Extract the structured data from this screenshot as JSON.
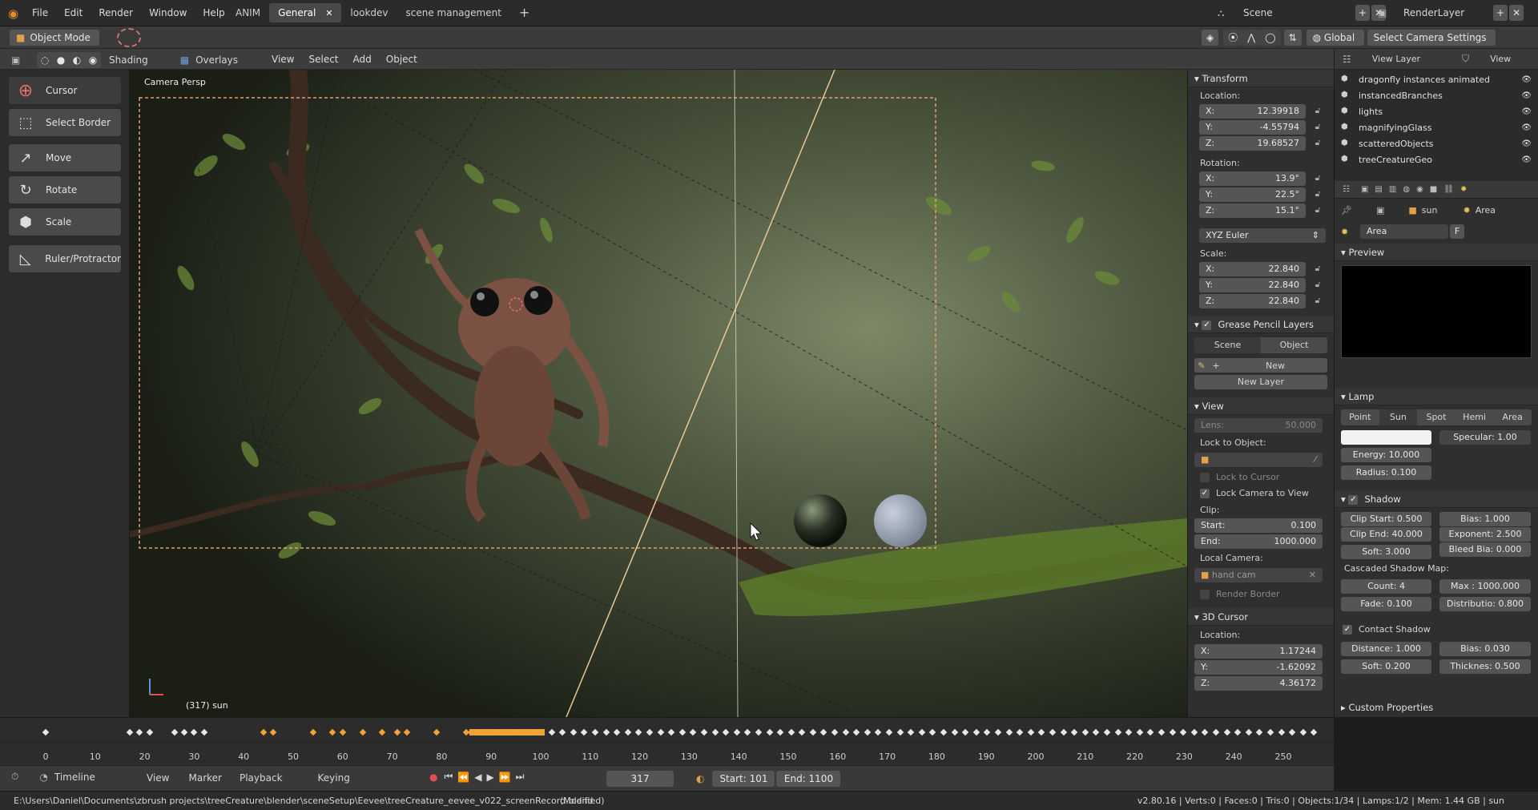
{
  "menu": {
    "items": [
      "File",
      "Edit",
      "Render",
      "Window",
      "Help"
    ]
  },
  "workspace_tabs": [
    "ANIM",
    "General",
    "lookdev",
    "scene management"
  ],
  "scene": {
    "label": "Scene",
    "render_layer": "RenderLayer"
  },
  "header2": {
    "mode": "Object Mode",
    "transform_orientation": "Global",
    "camera_settings": "Select Camera Settings"
  },
  "header3": {
    "shading": "Shading",
    "overlays": "Overlays",
    "menus": [
      "View",
      "Select",
      "Add",
      "Object"
    ]
  },
  "outliner_header": {
    "view_layer": "View Layer",
    "view": "View"
  },
  "tools": [
    "Cursor",
    "Select Border",
    "Move",
    "Rotate",
    "Scale",
    "Ruler/Protractor"
  ],
  "viewport": {
    "title": "Camera Persp",
    "frame_info": "(317) sun"
  },
  "npanel": {
    "transform": {
      "title": "Transform",
      "location_label": "Location:",
      "location": [
        {
          "axis": "X:",
          "value": "12.39918"
        },
        {
          "axis": "Y:",
          "value": "-4.55794"
        },
        {
          "axis": "Z:",
          "value": "19.68527"
        }
      ],
      "rotation_label": "Rotation:",
      "rotation": [
        {
          "axis": "X:",
          "value": "13.9°"
        },
        {
          "axis": "Y:",
          "value": "22.5°"
        },
        {
          "axis": "Z:",
          "value": "15.1°"
        }
      ],
      "euler": "XYZ Euler",
      "scale_label": "Scale:",
      "scale": [
        {
          "axis": "X:",
          "value": "22.840"
        },
        {
          "axis": "Y:",
          "value": "22.840"
        },
        {
          "axis": "Z:",
          "value": "22.840"
        }
      ]
    },
    "grease": {
      "title": "Grease Pencil Layers",
      "scene": "Scene",
      "object": "Object",
      "new": "New",
      "new_layer": "New Layer"
    },
    "view": {
      "title": "View",
      "lens_label": "Lens:",
      "lens": "50.000",
      "lock_object": "Lock to Object:",
      "lock_cursor": "Lock to Cursor",
      "lock_camera": "Lock Camera to View",
      "clip": "Clip:",
      "clip_start_label": "Start:",
      "clip_start": "0.100",
      "clip_end_label": "End:",
      "clip_end": "1000.000",
      "local_camera": "Local Camera:",
      "local_camera_value": "hand cam",
      "render_border": "Render Border"
    },
    "cursor": {
      "title": "3D Cursor",
      "location_label": "Location:",
      "location": [
        {
          "axis": "X:",
          "value": "1.17244"
        },
        {
          "axis": "Y:",
          "value": "-1.62092"
        },
        {
          "axis": "Z:",
          "value": "4.36172"
        }
      ]
    }
  },
  "outliner": {
    "items": [
      "dragonfly instances animated",
      "instancedBranches",
      "lights",
      "magnifyingGlass",
      "scatteredObjects",
      "treeCreatureGeo"
    ]
  },
  "properties": {
    "object": "sun",
    "data": "Area",
    "datablock": "Area",
    "fake_user": "F",
    "preview": "Preview",
    "lamp": {
      "title": "Lamp",
      "types": [
        "Point",
        "Sun",
        "Spot",
        "Hemi",
        "Area"
      ],
      "active": "Sun",
      "specular": "Specular:",
      "specular_value": "1.00",
      "energy": "Energy:",
      "energy_value": "10.000",
      "radius": "Radius:",
      "radius_value": "0.100"
    },
    "shadow": {
      "title": "Shadow",
      "clip_start": "Clip Start:",
      "clip_start_value": "0.500",
      "bias": "Bias:",
      "bias_value": "1.000",
      "clip_end": "Clip End:",
      "clip_end_value": "40.000",
      "exponent": "Exponent:",
      "exponent_value": "2.500",
      "soft": "Soft:",
      "soft_value": "3.000",
      "bleed": "Bleed Bia:",
      "bleed_value": "0.000",
      "cascaded": "Cascaded Shadow Map:",
      "count": "Count:",
      "count_value": "4",
      "max": "Max :",
      "max_value": "1000.000",
      "fade": "Fade:",
      "fade_value": "0.100",
      "distribution": "Distributio:",
      "distribution_value": "0.800"
    },
    "contact": {
      "title": "Contact Shadow",
      "distance": "Distance:",
      "distance_value": "1.000",
      "bias": "Bias:",
      "bias_value": "0.030",
      "soft": "Soft:",
      "soft_value": "0.200",
      "thickness": "Thicknes:",
      "thickness_value": "0.500"
    },
    "custom": "Custom Properties"
  },
  "timeline": {
    "ticks": [
      "0",
      "10",
      "20",
      "30",
      "40",
      "50",
      "60",
      "70",
      "80",
      "90",
      "100",
      "110",
      "120",
      "130",
      "140",
      "150",
      "160",
      "170",
      "180",
      "190",
      "200",
      "210",
      "220",
      "230",
      "240",
      "250"
    ],
    "editor": "Timeline",
    "menus": [
      "View",
      "Marker",
      "Playback",
      "Keying"
    ],
    "current_frame": "317",
    "start": "Start: 101",
    "end": "End: 1100"
  },
  "status": {
    "path": "E:\\Users\\Daniel\\Documents\\zbrush projects\\treeCreature\\blender\\sceneSetup\\Eevee\\treeCreature_eevee_v022_screenRecord.blend",
    "modified": "(Modified)",
    "stats": "v2.80.16 | Verts:0 | Faces:0 | Tris:0 | Objects:1/34 | Lamps:1/2 | Mem: 1.44 GB | sun"
  },
  "colors": {
    "accent": "#5680c2",
    "keyframe": "#f0a33a",
    "selection": "#e0a070"
  }
}
